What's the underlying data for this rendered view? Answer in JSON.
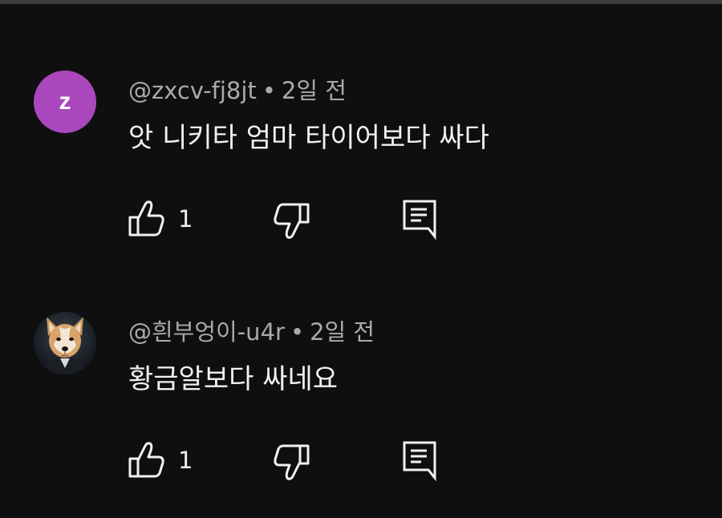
{
  "comments": [
    {
      "avatar_letter": "z",
      "avatar_color": "#ab47bc",
      "handle": "@zxcv-fj8jt",
      "separator": "•",
      "time": "2일 전",
      "text": "앗 니키타 엄마 타이어보다 싸다",
      "like_count": "1"
    },
    {
      "avatar_icon": "dog-avatar-image",
      "handle": "@흰부엉이-u4r",
      "separator": "•",
      "time": "2일 전",
      "text": "황금알보다 싸네요",
      "like_count": "1"
    }
  ],
  "icons": {
    "like": "thumb-up-icon",
    "dislike": "thumb-down-icon",
    "reply": "comment-reply-icon"
  },
  "theme": {
    "background": "#0f0f0f",
    "primary_text": "#f1f1f1",
    "secondary_text": "#aaaaaa"
  }
}
